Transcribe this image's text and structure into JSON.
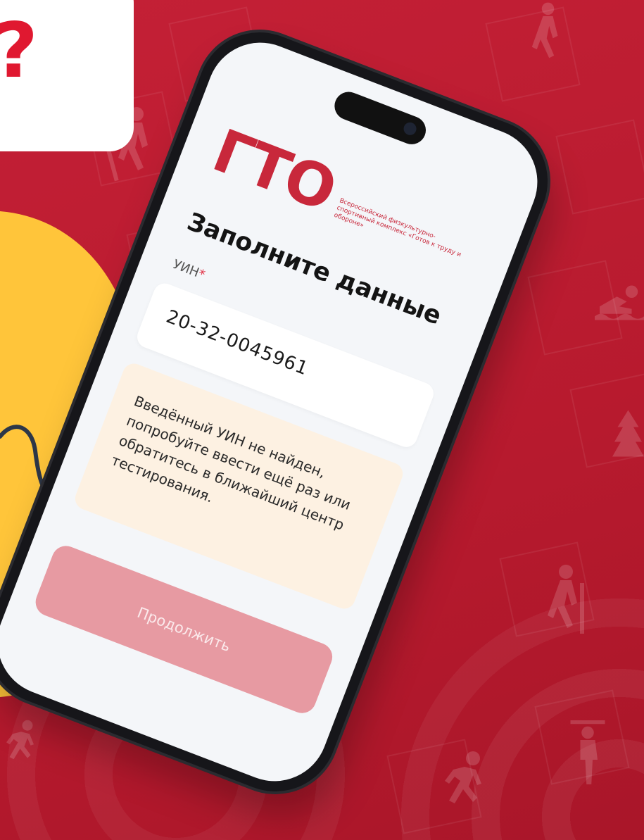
{
  "bubble": {
    "text": "!?"
  },
  "phone": {
    "logo": {
      "mark": "ГТО",
      "subtitle": "Всероссийский физкультурно-спортивный комплекс «Готов к труду и обороне»"
    },
    "title": "Заполните данные",
    "uin_field": {
      "label": "УИН",
      "required_mark": "*",
      "value": "20-32-0045961"
    },
    "alert": {
      "lines": [
        "Введённый УИН не найден,",
        "попробуйте ввести ещё раз или",
        "обратитесь в ближайший центр",
        "тестирования."
      ]
    },
    "continue_button": {
      "label": "Продолжить"
    }
  },
  "colors": {
    "background": "#b81c2f",
    "accent": "#c8283b",
    "button_disabled": "#e79aa2",
    "alert_bg": "#fdf1e2",
    "emoji": "#ffc53a"
  },
  "icons": [
    "sport-figure-icon",
    "skier-icon",
    "runner-icon",
    "swimmer-icon",
    "target-icon",
    "tree-icon"
  ]
}
